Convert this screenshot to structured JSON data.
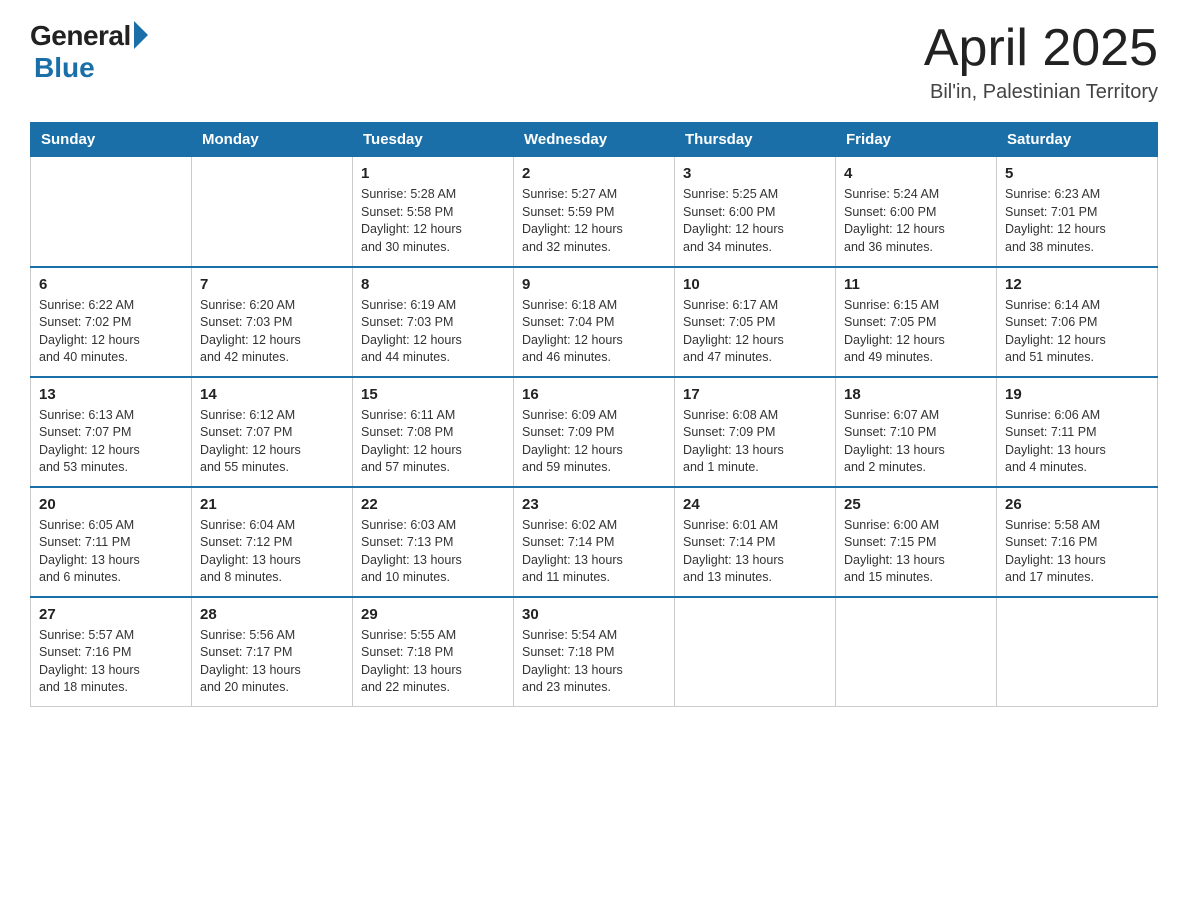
{
  "header": {
    "logo_general": "General",
    "logo_blue": "Blue",
    "month_year": "April 2025",
    "location": "Bil'in, Palestinian Territory"
  },
  "days_of_week": [
    "Sunday",
    "Monday",
    "Tuesday",
    "Wednesday",
    "Thursday",
    "Friday",
    "Saturday"
  ],
  "weeks": [
    [
      {
        "day": "",
        "info": ""
      },
      {
        "day": "",
        "info": ""
      },
      {
        "day": "1",
        "info": "Sunrise: 5:28 AM\nSunset: 5:58 PM\nDaylight: 12 hours\nand 30 minutes."
      },
      {
        "day": "2",
        "info": "Sunrise: 5:27 AM\nSunset: 5:59 PM\nDaylight: 12 hours\nand 32 minutes."
      },
      {
        "day": "3",
        "info": "Sunrise: 5:25 AM\nSunset: 6:00 PM\nDaylight: 12 hours\nand 34 minutes."
      },
      {
        "day": "4",
        "info": "Sunrise: 5:24 AM\nSunset: 6:00 PM\nDaylight: 12 hours\nand 36 minutes."
      },
      {
        "day": "5",
        "info": "Sunrise: 6:23 AM\nSunset: 7:01 PM\nDaylight: 12 hours\nand 38 minutes."
      }
    ],
    [
      {
        "day": "6",
        "info": "Sunrise: 6:22 AM\nSunset: 7:02 PM\nDaylight: 12 hours\nand 40 minutes."
      },
      {
        "day": "7",
        "info": "Sunrise: 6:20 AM\nSunset: 7:03 PM\nDaylight: 12 hours\nand 42 minutes."
      },
      {
        "day": "8",
        "info": "Sunrise: 6:19 AM\nSunset: 7:03 PM\nDaylight: 12 hours\nand 44 minutes."
      },
      {
        "day": "9",
        "info": "Sunrise: 6:18 AM\nSunset: 7:04 PM\nDaylight: 12 hours\nand 46 minutes."
      },
      {
        "day": "10",
        "info": "Sunrise: 6:17 AM\nSunset: 7:05 PM\nDaylight: 12 hours\nand 47 minutes."
      },
      {
        "day": "11",
        "info": "Sunrise: 6:15 AM\nSunset: 7:05 PM\nDaylight: 12 hours\nand 49 minutes."
      },
      {
        "day": "12",
        "info": "Sunrise: 6:14 AM\nSunset: 7:06 PM\nDaylight: 12 hours\nand 51 minutes."
      }
    ],
    [
      {
        "day": "13",
        "info": "Sunrise: 6:13 AM\nSunset: 7:07 PM\nDaylight: 12 hours\nand 53 minutes."
      },
      {
        "day": "14",
        "info": "Sunrise: 6:12 AM\nSunset: 7:07 PM\nDaylight: 12 hours\nand 55 minutes."
      },
      {
        "day": "15",
        "info": "Sunrise: 6:11 AM\nSunset: 7:08 PM\nDaylight: 12 hours\nand 57 minutes."
      },
      {
        "day": "16",
        "info": "Sunrise: 6:09 AM\nSunset: 7:09 PM\nDaylight: 12 hours\nand 59 minutes."
      },
      {
        "day": "17",
        "info": "Sunrise: 6:08 AM\nSunset: 7:09 PM\nDaylight: 13 hours\nand 1 minute."
      },
      {
        "day": "18",
        "info": "Sunrise: 6:07 AM\nSunset: 7:10 PM\nDaylight: 13 hours\nand 2 minutes."
      },
      {
        "day": "19",
        "info": "Sunrise: 6:06 AM\nSunset: 7:11 PM\nDaylight: 13 hours\nand 4 minutes."
      }
    ],
    [
      {
        "day": "20",
        "info": "Sunrise: 6:05 AM\nSunset: 7:11 PM\nDaylight: 13 hours\nand 6 minutes."
      },
      {
        "day": "21",
        "info": "Sunrise: 6:04 AM\nSunset: 7:12 PM\nDaylight: 13 hours\nand 8 minutes."
      },
      {
        "day": "22",
        "info": "Sunrise: 6:03 AM\nSunset: 7:13 PM\nDaylight: 13 hours\nand 10 minutes."
      },
      {
        "day": "23",
        "info": "Sunrise: 6:02 AM\nSunset: 7:14 PM\nDaylight: 13 hours\nand 11 minutes."
      },
      {
        "day": "24",
        "info": "Sunrise: 6:01 AM\nSunset: 7:14 PM\nDaylight: 13 hours\nand 13 minutes."
      },
      {
        "day": "25",
        "info": "Sunrise: 6:00 AM\nSunset: 7:15 PM\nDaylight: 13 hours\nand 15 minutes."
      },
      {
        "day": "26",
        "info": "Sunrise: 5:58 AM\nSunset: 7:16 PM\nDaylight: 13 hours\nand 17 minutes."
      }
    ],
    [
      {
        "day": "27",
        "info": "Sunrise: 5:57 AM\nSunset: 7:16 PM\nDaylight: 13 hours\nand 18 minutes."
      },
      {
        "day": "28",
        "info": "Sunrise: 5:56 AM\nSunset: 7:17 PM\nDaylight: 13 hours\nand 20 minutes."
      },
      {
        "day": "29",
        "info": "Sunrise: 5:55 AM\nSunset: 7:18 PM\nDaylight: 13 hours\nand 22 minutes."
      },
      {
        "day": "30",
        "info": "Sunrise: 5:54 AM\nSunset: 7:18 PM\nDaylight: 13 hours\nand 23 minutes."
      },
      {
        "day": "",
        "info": ""
      },
      {
        "day": "",
        "info": ""
      },
      {
        "day": "",
        "info": ""
      }
    ]
  ]
}
